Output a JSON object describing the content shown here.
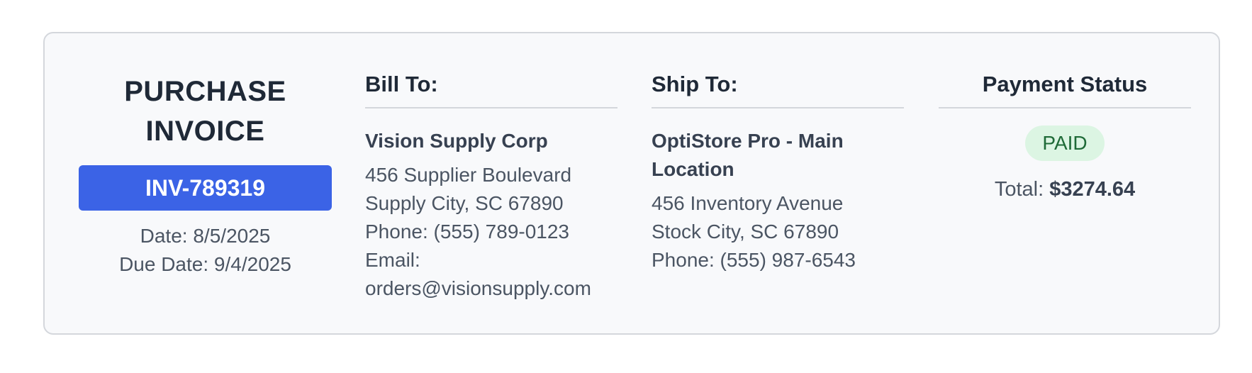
{
  "invoice": {
    "title": "PURCHASE INVOICE",
    "number": "INV-789319",
    "date_label": "Date:",
    "date": "8/5/2025",
    "due_date_label": "Due Date:",
    "due_date": "9/4/2025"
  },
  "bill_to": {
    "heading": "Bill To:",
    "name": "Vision Supply Corp",
    "lines": [
      "456 Supplier Boulevard",
      "Supply City, SC 67890",
      "Phone: (555) 789-0123",
      "Email:",
      "orders@visionsupply.com"
    ]
  },
  "ship_to": {
    "heading": "Ship To:",
    "name": "OptiStore Pro - Main Location",
    "lines": [
      "456 Inventory Avenue",
      "Stock City, SC 67890",
      "Phone: (555) 987-6543"
    ]
  },
  "payment": {
    "heading": "Payment Status",
    "status": "PAID",
    "total_label": "Total:",
    "total_amount": "$3274.64"
  },
  "colors": {
    "accent": "#3b63e6",
    "paid_bg": "#dcf5e3",
    "paid_text": "#1f6b38",
    "card_bg": "#f8f9fb",
    "border": "#d4d7dc"
  }
}
